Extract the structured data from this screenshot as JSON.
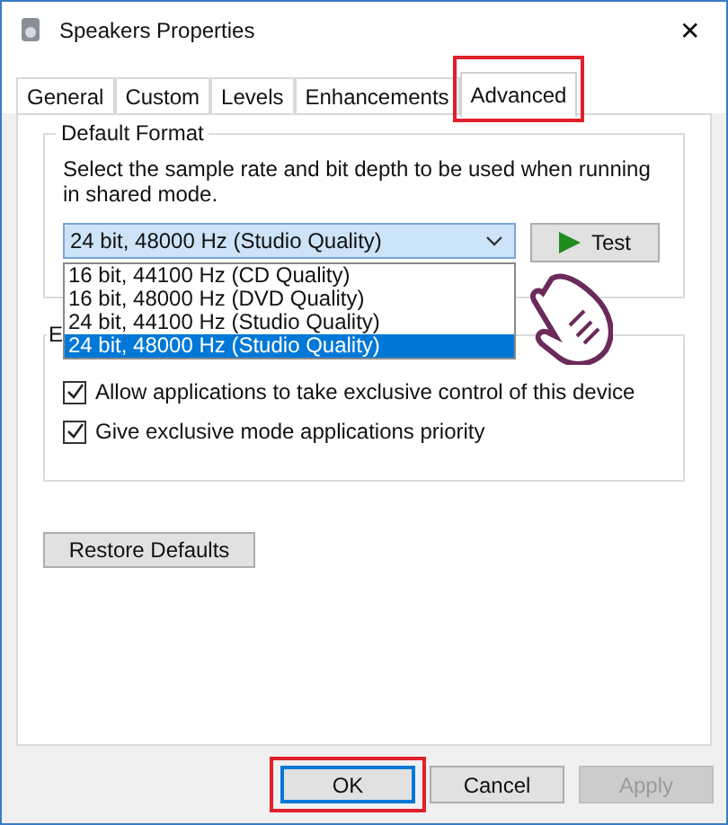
{
  "window": {
    "title": "Speakers Properties",
    "close": "✕"
  },
  "tabs": [
    {
      "label": "General",
      "selected": false
    },
    {
      "label": "Custom",
      "selected": false
    },
    {
      "label": "Levels",
      "selected": false
    },
    {
      "label": "Enhancements",
      "selected": false
    },
    {
      "label": "Advanced",
      "selected": true,
      "highlighted": true
    }
  ],
  "default_format": {
    "title": "Default Format",
    "description": "Select the sample rate and bit depth to be used when running in shared mode.",
    "value": "24 bit, 48000 Hz (Studio Quality)",
    "test_button": "Test",
    "expanded": true,
    "options": [
      {
        "label": "16 bit, 44100 Hz (CD Quality)",
        "selected": false
      },
      {
        "label": "16 bit, 48000 Hz (DVD Quality)",
        "selected": false
      },
      {
        "label": "24 bit, 44100 Hz (Studio Quality)",
        "selected": false
      },
      {
        "label": "24 bit, 48000 Hz (Studio Quality)",
        "selected": true
      }
    ]
  },
  "exclusive_mode": {
    "title": "E",
    "options": [
      {
        "label": "Allow applications to take exclusive control of this device",
        "checked": true
      },
      {
        "label": "Give exclusive mode applications priority",
        "checked": true
      }
    ]
  },
  "restore_button": "Restore Defaults",
  "buttons": [
    {
      "label": "OK",
      "default": true,
      "disabled": false,
      "highlighted": true
    },
    {
      "label": "Cancel",
      "default": false,
      "disabled": false,
      "highlighted": false
    },
    {
      "label": "Apply",
      "default": false,
      "disabled": true,
      "highlighted": false
    }
  ]
}
